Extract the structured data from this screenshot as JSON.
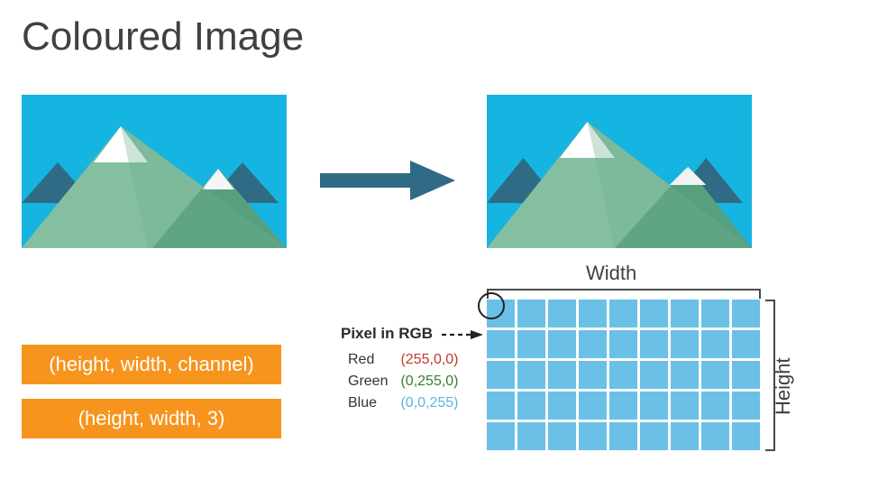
{
  "title": "Coloured Image",
  "boxes": {
    "shape_generic": "(height, width, channel)",
    "shape_rgb": "(height, width, 3)"
  },
  "pixel_label": "Pixel in RGB",
  "rgb": {
    "red": {
      "name": "Red",
      "tuple": "(255,0,0)",
      "color": "#C0392B"
    },
    "green": {
      "name": "Green",
      "tuple": "(0,255,0)",
      "color": "#3A7D2E"
    },
    "blue": {
      "name": "Blue",
      "tuple": "(0,0,255)",
      "color": "#5BB4E5"
    }
  },
  "dims": {
    "width_label": "Width",
    "height_label": "Height"
  },
  "grid": {
    "cols": 9,
    "rows": 5
  }
}
